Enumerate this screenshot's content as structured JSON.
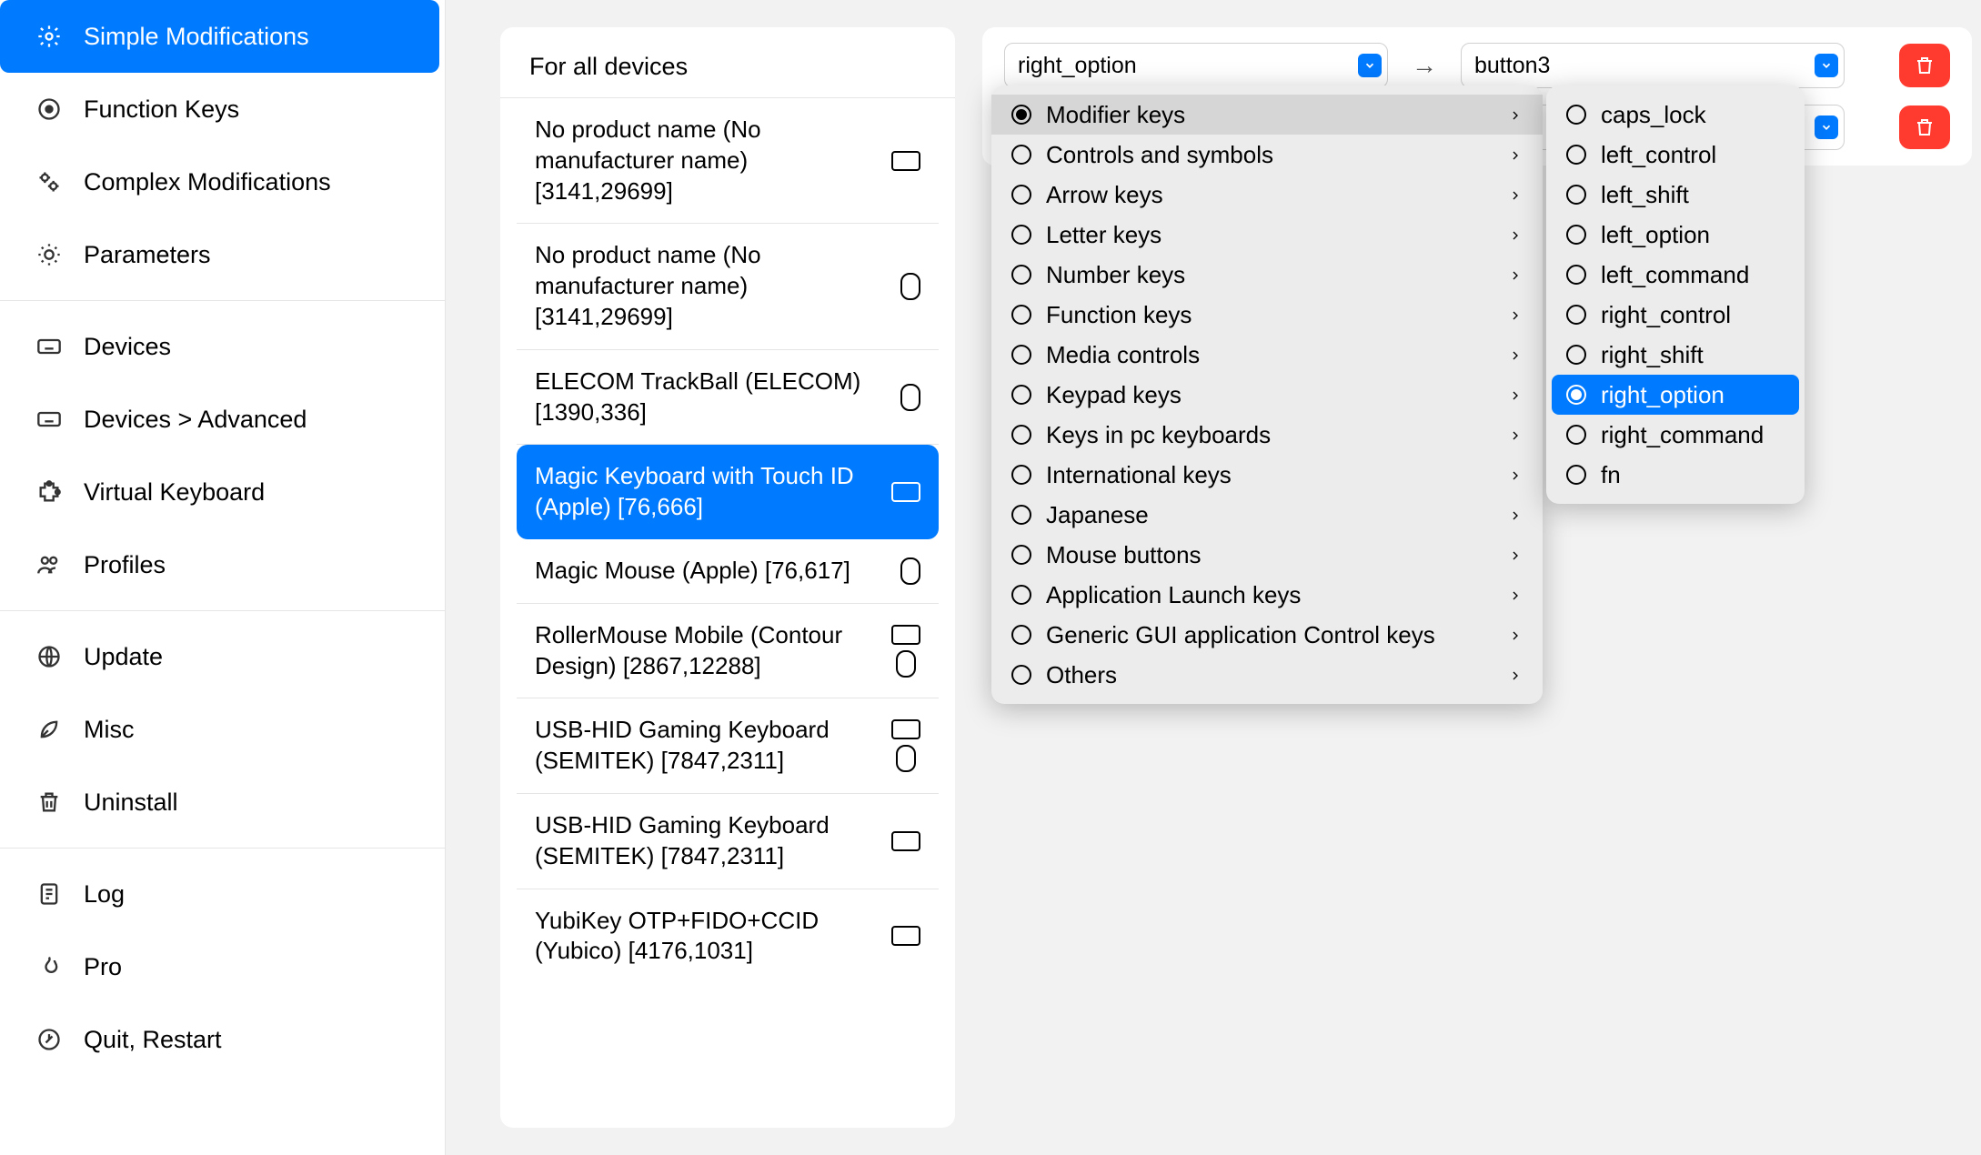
{
  "sidebar": {
    "groups": [
      [
        {
          "icon": "gear",
          "label": "Simple Modifications",
          "active": true
        },
        {
          "icon": "target",
          "label": "Function Keys"
        },
        {
          "icon": "gears",
          "label": "Complex Modifications"
        },
        {
          "icon": "brightness",
          "label": "Parameters"
        }
      ],
      [
        {
          "icon": "keyboard",
          "label": "Devices"
        },
        {
          "icon": "keyboard",
          "label": "Devices > Advanced"
        },
        {
          "icon": "puzzle",
          "label": "Virtual Keyboard"
        },
        {
          "icon": "people",
          "label": "Profiles"
        }
      ],
      [
        {
          "icon": "globe",
          "label": "Update"
        },
        {
          "icon": "leaf",
          "label": "Misc"
        },
        {
          "icon": "trash",
          "label": "Uninstall"
        }
      ],
      [
        {
          "icon": "doc",
          "label": "Log"
        },
        {
          "icon": "fire",
          "label": "Pro"
        },
        {
          "icon": "power",
          "label": "Quit, Restart"
        }
      ]
    ]
  },
  "devices": {
    "header": "For all devices",
    "items": [
      {
        "label": "No product name (No manufacturer name) [3141,29699]",
        "icons": [
          "kb"
        ]
      },
      {
        "label": "No product name (No manufacturer name) [3141,29699]",
        "icons": [
          "mouse"
        ]
      },
      {
        "label": "ELECOM TrackBall (ELECOM) [1390,336]",
        "icons": [
          "mouse"
        ]
      },
      {
        "label": "Magic Keyboard with Touch ID (Apple) [76,666]",
        "icons": [
          "kb"
        ],
        "selected": true
      },
      {
        "label": "Magic Mouse (Apple) [76,617]",
        "icons": [
          "mouse"
        ]
      },
      {
        "label": "RollerMouse Mobile (Contour Design) [2867,12288]",
        "icons": [
          "kb",
          "mouse"
        ]
      },
      {
        "label": "USB-HID Gaming Keyboard (SEMITEK) [7847,2311]",
        "icons": [
          "kb",
          "mouse"
        ]
      },
      {
        "label": "USB-HID Gaming Keyboard (SEMITEK) [7847,2311]",
        "icons": [
          "kb"
        ]
      },
      {
        "label": "YubiKey OTP+FIDO+CCID (Yubico) [4176,1031]",
        "icons": [
          "kb"
        ]
      }
    ]
  },
  "mappings": [
    {
      "from": "right_option",
      "to": "button3"
    },
    {
      "from": "",
      "to": ""
    }
  ],
  "menu_categories": [
    "Modifier keys",
    "Controls and symbols",
    "Arrow keys",
    "Letter keys",
    "Number keys",
    "Function keys",
    "Media controls",
    "Keypad keys",
    "Keys in pc keyboards",
    "International keys",
    "Japanese",
    "Mouse buttons",
    "Application Launch keys",
    "Generic GUI application Control keys",
    "Others"
  ],
  "menu_category_selected": "Modifier keys",
  "menu_values": [
    "caps_lock",
    "left_control",
    "left_shift",
    "left_option",
    "left_command",
    "right_control",
    "right_shift",
    "right_option",
    "right_command",
    "fn"
  ],
  "menu_value_selected": "right_option"
}
